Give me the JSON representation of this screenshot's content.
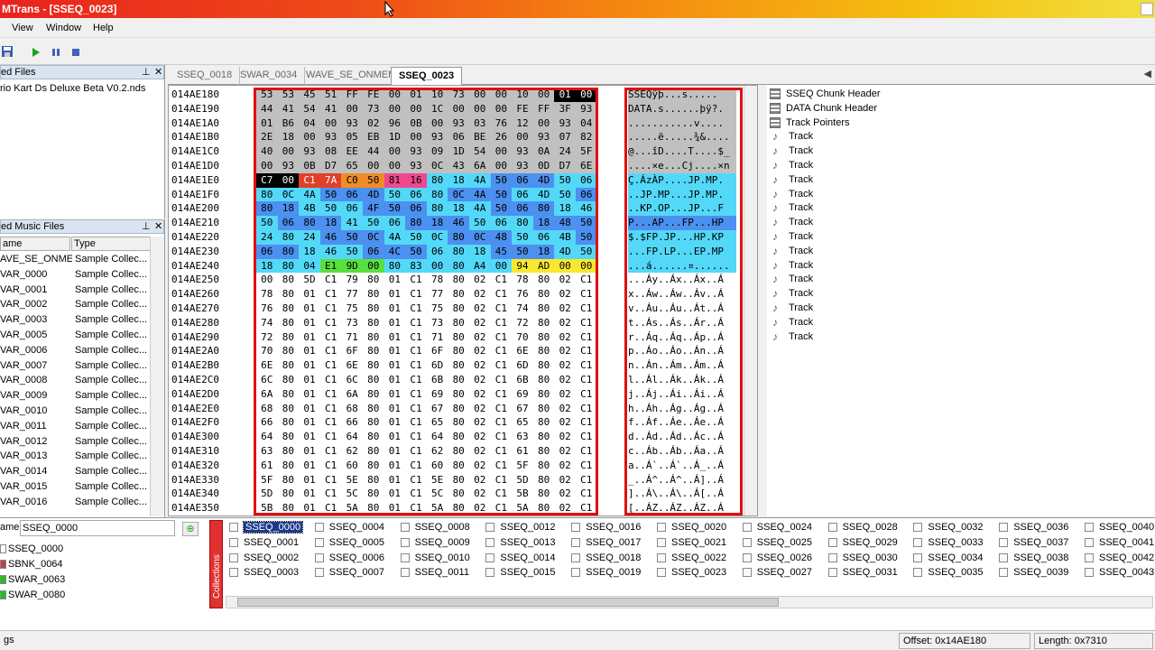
{
  "app": {
    "title": "MTrans - [SSEQ_0023]"
  },
  "menu": {
    "items": [
      "View",
      "Window",
      "Help"
    ]
  },
  "toolbar": {
    "icons": [
      "save-icon",
      "play-icon",
      "pause-icon",
      "stop-icon"
    ]
  },
  "loaded_files": {
    "title": "ed Files",
    "items": [
      "rio Kart Ds Deluxe Beta V0.2.nds"
    ]
  },
  "music_files": {
    "title": "ed Music Files",
    "col_name": "ame",
    "col_type": "Type",
    "rows": [
      [
        "AVE_SE_ONMEM",
        "Sample Collec..."
      ],
      [
        "VAR_0000",
        "Sample Collec..."
      ],
      [
        "VAR_0001",
        "Sample Collec..."
      ],
      [
        "VAR_0002",
        "Sample Collec..."
      ],
      [
        "VAR_0003",
        "Sample Collec..."
      ],
      [
        "VAR_0005",
        "Sample Collec..."
      ],
      [
        "VAR_0006",
        "Sample Collec..."
      ],
      [
        "VAR_0007",
        "Sample Collec..."
      ],
      [
        "VAR_0008",
        "Sample Collec..."
      ],
      [
        "VAR_0009",
        "Sample Collec..."
      ],
      [
        "VAR_0010",
        "Sample Collec..."
      ],
      [
        "VAR_0011",
        "Sample Collec..."
      ],
      [
        "VAR_0012",
        "Sample Collec..."
      ],
      [
        "VAR_0013",
        "Sample Collec..."
      ],
      [
        "VAR_0014",
        "Sample Collec..."
      ],
      [
        "VAR_0015",
        "Sample Collec..."
      ],
      [
        "VAR_0016",
        "Sample Collec..."
      ]
    ]
  },
  "tabs": [
    {
      "label": "SSEQ_0018"
    },
    {
      "label": "SWAR_0034"
    },
    {
      "label": "WAVE_SE_ONMEM"
    },
    {
      "label": "SSEQ_0023",
      "active": true
    }
  ],
  "hex": {
    "rows": [
      {
        "addr": "014AE180",
        "bytes": [
          "53",
          "53",
          "45",
          "51",
          "FF",
          "FE",
          "00",
          "01",
          "10",
          "73",
          "00",
          "00",
          "10",
          "00",
          "01",
          "00"
        ],
        "ascii": "SSEQÿþ...s....."
      },
      {
        "addr": "014AE190",
        "bytes": [
          "44",
          "41",
          "54",
          "41",
          "00",
          "73",
          "00",
          "00",
          "1C",
          "00",
          "00",
          "00",
          "FE",
          "FF",
          "3F",
          "93"
        ],
        "ascii": "DATA.s......þÿ?."
      },
      {
        "addr": "014AE1A0",
        "bytes": [
          "01",
          "B6",
          "04",
          "00",
          "93",
          "02",
          "96",
          "0B",
          "00",
          "93",
          "03",
          "76",
          "12",
          "00",
          "93",
          "04"
        ],
        "ascii": "...........v...."
      },
      {
        "addr": "014AE1B0",
        "bytes": [
          "2E",
          "18",
          "00",
          "93",
          "05",
          "EB",
          "1D",
          "00",
          "93",
          "06",
          "BE",
          "26",
          "00",
          "93",
          "07",
          "82"
        ],
        "ascii": ".....ë.....¾&...."
      },
      {
        "addr": "014AE1C0",
        "bytes": [
          "40",
          "00",
          "93",
          "08",
          "EE",
          "44",
          "00",
          "93",
          "09",
          "1D",
          "54",
          "00",
          "93",
          "0A",
          "24",
          "5F"
        ],
        "ascii": "@...îD....T....$_"
      },
      {
        "addr": "014AE1D0",
        "bytes": [
          "00",
          "93",
          "0B",
          "D7",
          "65",
          "00",
          "00",
          "93",
          "0C",
          "43",
          "6A",
          "00",
          "93",
          "0D",
          "D7",
          "6E"
        ],
        "ascii": "....×e...Cj....×n"
      },
      {
        "addr": "014AE1E0",
        "bytes": [
          "C7",
          "00",
          "C1",
          "7A",
          "C0",
          "50",
          "81",
          "16",
          "80",
          "18",
          "4A",
          "50",
          "06",
          "4D",
          "50",
          "06"
        ],
        "ascii": "Ç.ÁzÀP....JP.MP."
      },
      {
        "addr": "014AE1F0",
        "bytes": [
          "80",
          "0C",
          "4A",
          "50",
          "06",
          "4D",
          "50",
          "06",
          "80",
          "0C",
          "4A",
          "50",
          "06",
          "4D",
          "50",
          "06"
        ],
        "ascii": "..JP.MP...JP.MP."
      },
      {
        "addr": "014AE200",
        "bytes": [
          "80",
          "18",
          "4B",
          "50",
          "06",
          "4F",
          "50",
          "06",
          "80",
          "18",
          "4A",
          "50",
          "06",
          "80",
          "18",
          "46"
        ],
        "ascii": "..KP.OP...JP...F"
      },
      {
        "addr": "014AE210",
        "bytes": [
          "50",
          "06",
          "80",
          "18",
          "41",
          "50",
          "06",
          "80",
          "18",
          "46",
          "50",
          "06",
          "80",
          "18",
          "48",
          "50"
        ],
        "ascii": "P...AP...FP...HP"
      },
      {
        "addr": "014AE220",
        "bytes": [
          "24",
          "80",
          "24",
          "46",
          "50",
          "0C",
          "4A",
          "50",
          "0C",
          "80",
          "0C",
          "48",
          "50",
          "06",
          "4B",
          "50"
        ],
        "ascii": "$.$FP.JP...HP.KP"
      },
      {
        "addr": "014AE230",
        "bytes": [
          "06",
          "80",
          "18",
          "46",
          "50",
          "06",
          "4C",
          "50",
          "06",
          "80",
          "18",
          "45",
          "50",
          "18",
          "4D",
          "50"
        ],
        "ascii": "...FP.LP...EP.MP"
      },
      {
        "addr": "014AE240",
        "bytes": [
          "18",
          "80",
          "04",
          "E1",
          "9D",
          "00",
          "80",
          "83",
          "00",
          "80",
          "A4",
          "00",
          "94",
          "AD",
          "00",
          "00"
        ],
        "ascii": "...á......¤......"
      },
      {
        "addr": "014AE250",
        "bytes": [
          "00",
          "80",
          "5D",
          "C1",
          "79",
          "80",
          "01",
          "C1",
          "78",
          "80",
          "02",
          "C1",
          "78",
          "80",
          "02",
          "C1"
        ],
        "ascii": "...Áy..Áx..Áx..Á"
      },
      {
        "addr": "014AE260",
        "bytes": [
          "78",
          "80",
          "01",
          "C1",
          "77",
          "80",
          "01",
          "C1",
          "77",
          "80",
          "02",
          "C1",
          "76",
          "80",
          "02",
          "C1"
        ],
        "ascii": "x..Áw..Áw..Áv..Á"
      },
      {
        "addr": "014AE270",
        "bytes": [
          "76",
          "80",
          "01",
          "C1",
          "75",
          "80",
          "01",
          "C1",
          "75",
          "80",
          "02",
          "C1",
          "74",
          "80",
          "02",
          "C1"
        ],
        "ascii": "v..Áu..Áu..Át..Á"
      },
      {
        "addr": "014AE280",
        "bytes": [
          "74",
          "80",
          "01",
          "C1",
          "73",
          "80",
          "01",
          "C1",
          "73",
          "80",
          "02",
          "C1",
          "72",
          "80",
          "02",
          "C1"
        ],
        "ascii": "t..Ás..Ás..Ár..Á"
      },
      {
        "addr": "014AE290",
        "bytes": [
          "72",
          "80",
          "01",
          "C1",
          "71",
          "80",
          "01",
          "C1",
          "71",
          "80",
          "02",
          "C1",
          "70",
          "80",
          "02",
          "C1"
        ],
        "ascii": "r..Áq..Áq..Áp..Á"
      },
      {
        "addr": "014AE2A0",
        "bytes": [
          "70",
          "80",
          "01",
          "C1",
          "6F",
          "80",
          "01",
          "C1",
          "6F",
          "80",
          "02",
          "C1",
          "6E",
          "80",
          "02",
          "C1"
        ],
        "ascii": "p..Áo..Áo..Án..Á"
      },
      {
        "addr": "014AE2B0",
        "bytes": [
          "6E",
          "80",
          "01",
          "C1",
          "6E",
          "80",
          "01",
          "C1",
          "6D",
          "80",
          "02",
          "C1",
          "6D",
          "80",
          "02",
          "C1"
        ],
        "ascii": "n..Án..Ám..Ám..Á"
      },
      {
        "addr": "014AE2C0",
        "bytes": [
          "6C",
          "80",
          "01",
          "C1",
          "6C",
          "80",
          "01",
          "C1",
          "6B",
          "80",
          "02",
          "C1",
          "6B",
          "80",
          "02",
          "C1"
        ],
        "ascii": "l..Ál..Ák..Ák..Á"
      },
      {
        "addr": "014AE2D0",
        "bytes": [
          "6A",
          "80",
          "01",
          "C1",
          "6A",
          "80",
          "01",
          "C1",
          "69",
          "80",
          "02",
          "C1",
          "69",
          "80",
          "02",
          "C1"
        ],
        "ascii": "j..Áj..Ái..Ái..Á"
      },
      {
        "addr": "014AE2E0",
        "bytes": [
          "68",
          "80",
          "01",
          "C1",
          "68",
          "80",
          "01",
          "C1",
          "67",
          "80",
          "02",
          "C1",
          "67",
          "80",
          "02",
          "C1"
        ],
        "ascii": "h..Áh..Ág..Ág..Á"
      },
      {
        "addr": "014AE2F0",
        "bytes": [
          "66",
          "80",
          "01",
          "C1",
          "66",
          "80",
          "01",
          "C1",
          "65",
          "80",
          "02",
          "C1",
          "65",
          "80",
          "02",
          "C1"
        ],
        "ascii": "f..Áf..Áe..Áe..Á"
      },
      {
        "addr": "014AE300",
        "bytes": [
          "64",
          "80",
          "01",
          "C1",
          "64",
          "80",
          "01",
          "C1",
          "64",
          "80",
          "02",
          "C1",
          "63",
          "80",
          "02",
          "C1"
        ],
        "ascii": "d..Ád..Ád..Ác..Á"
      },
      {
        "addr": "014AE310",
        "bytes": [
          "63",
          "80",
          "01",
          "C1",
          "62",
          "80",
          "01",
          "C1",
          "62",
          "80",
          "02",
          "C1",
          "61",
          "80",
          "02",
          "C1"
        ],
        "ascii": "c..Áb..Áb..Áa..Á"
      },
      {
        "addr": "014AE320",
        "bytes": [
          "61",
          "80",
          "01",
          "C1",
          "60",
          "80",
          "01",
          "C1",
          "60",
          "80",
          "02",
          "C1",
          "5F",
          "80",
          "02",
          "C1"
        ],
        "ascii": "a..Á`..Á`..Á_..Á"
      },
      {
        "addr": "014AE330",
        "bytes": [
          "5F",
          "80",
          "01",
          "C1",
          "5E",
          "80",
          "01",
          "C1",
          "5E",
          "80",
          "02",
          "C1",
          "5D",
          "80",
          "02",
          "C1"
        ],
        "ascii": "_..Á^..Á^..Á]..Á"
      },
      {
        "addr": "014AE340",
        "bytes": [
          "5D",
          "80",
          "01",
          "C1",
          "5C",
          "80",
          "01",
          "C1",
          "5C",
          "80",
          "02",
          "C1",
          "5B",
          "80",
          "02",
          "C1"
        ],
        "ascii": "]..Á\\..Á\\..Á[..Á"
      },
      {
        "addr": "014AE350",
        "bytes": [
          "5B",
          "80",
          "01",
          "C1",
          "5A",
          "80",
          "01",
          "C1",
          "5A",
          "80",
          "02",
          "C1",
          "5A",
          "80",
          "02",
          "C1"
        ],
        "ascii": "[..ÁZ..ÁZ..ÁZ..Á"
      }
    ],
    "colors": {
      "header": "#c0c0c0",
      "cyan": "#54d8f8",
      "blue": "#4c90f0",
      "orange": "#f08c28",
      "pink": "#f04890",
      "yellow": "#f8e830",
      "green": "#58e040",
      "red": "#e04028",
      "selection": "#000000"
    }
  },
  "tree": {
    "items": [
      "SSEQ Chunk Header",
      "DATA Chunk Header",
      "Track Pointers",
      "Track",
      "Track",
      "Track",
      "Track",
      "Track",
      "Track",
      "Track",
      "Track",
      "Track",
      "Track",
      "Track",
      "Track",
      "Track",
      "Track",
      "Track"
    ]
  },
  "bottom": {
    "name_label": "ame:",
    "name_value": "SSEQ_0000",
    "list": [
      {
        "label": "SSEQ_0000",
        "color": "#ffffff"
      },
      {
        "label": "SBNK_0064",
        "color": "#c04040"
      },
      {
        "label": "SWAR_0063",
        "color": "#20c020"
      },
      {
        "label": "SWAR_0080",
        "color": "#20c020"
      }
    ],
    "collections_label": "Collections",
    "grid": [
      "SSEQ_0000",
      "SSEQ_0001",
      "SSEQ_0002",
      "SSEQ_0003",
      "SSEQ_0004",
      "SSEQ_0005",
      "SSEQ_0006",
      "SSEQ_0007",
      "SSEQ_0008",
      "SSEQ_0009",
      "SSEQ_0010",
      "SSEQ_0011",
      "SSEQ_0012",
      "SSEQ_0013",
      "SSEQ_0014",
      "SSEQ_0015",
      "SSEQ_0016",
      "SSEQ_0017",
      "SSEQ_0018",
      "SSEQ_0019",
      "SSEQ_0020",
      "SSEQ_0021",
      "SSEQ_0022",
      "SSEQ_0023",
      "SSEQ_0024",
      "SSEQ_0025",
      "SSEQ_0026",
      "SSEQ_0027",
      "SSEQ_0028",
      "SSEQ_0029",
      "SSEQ_0030",
      "SSEQ_0031",
      "SSEQ_0032",
      "SSEQ_0033",
      "SSEQ_0034",
      "SSEQ_0035",
      "SSEQ_0036",
      "SSEQ_0037",
      "SSEQ_0038",
      "SSEQ_0039",
      "SSEQ_0040",
      "SSEQ_0041",
      "SSEQ_0042",
      "SSEQ_0043"
    ]
  },
  "status": {
    "left": "gs",
    "offset": "Offset: 0x14AE180",
    "length": "Length: 0x7310"
  }
}
